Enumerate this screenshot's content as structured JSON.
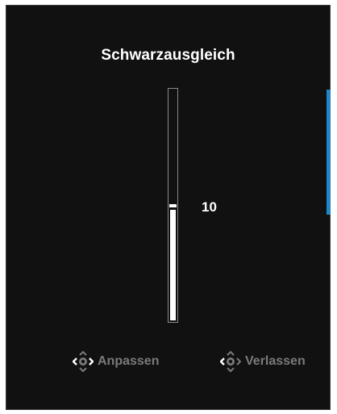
{
  "osd": {
    "title": "Schwarzausgleich",
    "accent_color": "#1f86c8"
  },
  "slider": {
    "value": "10",
    "fill_fraction": 0.48
  },
  "hints": {
    "adjust": {
      "icon": "joystick-icon",
      "label": "Anpassen"
    },
    "exit": {
      "icon": "joystick-icon",
      "label": "Verlassen"
    }
  }
}
